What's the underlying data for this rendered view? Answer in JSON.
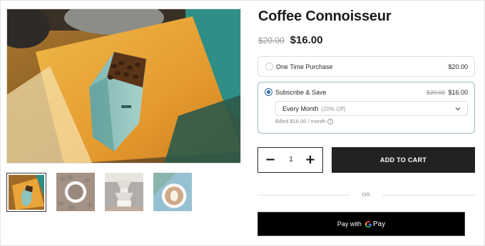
{
  "product": {
    "title": "Coffee Connoisseur",
    "old_price": "$20.00",
    "price": "$16.00"
  },
  "gallery": {
    "main_image": "coffee-bag-on-wooden-board",
    "thumbnails": [
      {
        "name": "coffee-bag-thumb",
        "selected": true
      },
      {
        "name": "coffee-beans-cup-thumb",
        "selected": false
      },
      {
        "name": "coffee-drip-stack-thumb",
        "selected": false
      },
      {
        "name": "latte-art-thumb",
        "selected": false
      }
    ]
  },
  "purchase_options": {
    "one_time": {
      "label": "One Time Purchase",
      "price": "$20.00",
      "selected": false
    },
    "subscribe": {
      "label": "Subscribe & Save",
      "old_price": "$20.00",
      "price": "$16.00",
      "selected": true,
      "frequency": "Every Month",
      "frequency_note": "(20% Off)",
      "billed": "Billed $16.00 / month"
    }
  },
  "quantity": {
    "minus": "−",
    "value": "1",
    "plus": "+"
  },
  "add_to_cart": "ADD TO CART",
  "or_label": "OR",
  "gpay": {
    "prefix": "Pay with",
    "brand": "Pay"
  },
  "colors": {
    "accent": "#2b6aa8",
    "button": "#222222",
    "subscribe_border": "#9ab9c2"
  }
}
